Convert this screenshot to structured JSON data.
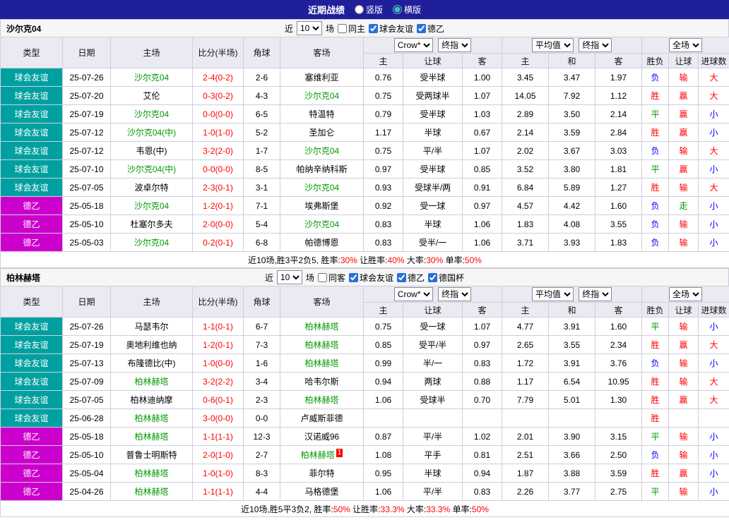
{
  "topbar": {
    "title": "近期战绩",
    "radio_vertical": "竖版",
    "radio_horizontal": "横版"
  },
  "controls": {
    "near": "近",
    "count": "10",
    "games": "场",
    "bookmaker": "Crow*",
    "final_index": "终指",
    "average": "平均值",
    "full_match": "全场"
  },
  "header": {
    "static": [
      "类型",
      "日期",
      "主场",
      "比分(半场)",
      "角球",
      "客场"
    ],
    "handicap": [
      "主",
      "让球",
      "客"
    ],
    "average": [
      "主",
      "和",
      "客"
    ],
    "result": [
      "胜负",
      "让球",
      "进球数"
    ]
  },
  "colors": {
    "topbar_bg": "#1f1f9c",
    "friendly_bg": "#00a0a0",
    "league2_bg": "#cc00cc",
    "focus_team": "#009900",
    "score": "#ff0000",
    "win": "#ff0000",
    "draw": "#009900",
    "lose": "#0000ff",
    "cover": "#ff0000",
    "push": "#009900",
    "over": "#ff0000",
    "under": "#0000ff"
  },
  "sections": [
    {
      "team": "沙尔克04",
      "same_label": "同主",
      "leagues": [
        "球会友谊",
        "德乙"
      ],
      "rows": [
        {
          "league": "球会友谊",
          "date": "25-07-26",
          "home": "沙尔克04",
          "home_focus": true,
          "score": "2-4(0-2)",
          "corners": "2-6",
          "away": "塞维利亚",
          "away_focus": false,
          "odds_home": "0.76",
          "handicap": "受半球",
          "odds_away": "1.00",
          "avg_home": "3.45",
          "avg_draw": "3.47",
          "avg_away": "1.97",
          "result": "负",
          "handicap_result": "输",
          "goals": "大"
        },
        {
          "league": "球会友谊",
          "date": "25-07-20",
          "home": "艾伦",
          "home_focus": false,
          "score": "0-3(0-2)",
          "corners": "4-3",
          "away": "沙尔克04",
          "away_focus": true,
          "odds_home": "0.75",
          "handicap": "受两球半",
          "odds_away": "1.07",
          "avg_home": "14.05",
          "avg_draw": "7.92",
          "avg_away": "1.12",
          "result": "胜",
          "handicap_result": "赢",
          "goals": "大"
        },
        {
          "league": "球会友谊",
          "date": "25-07-19",
          "home": "沙尔克04",
          "home_focus": true,
          "score": "0-0(0-0)",
          "corners": "6-5",
          "away": "特温特",
          "away_focus": false,
          "odds_home": "0.79",
          "handicap": "受半球",
          "odds_away": "1.03",
          "avg_home": "2.89",
          "avg_draw": "3.50",
          "avg_away": "2.14",
          "result": "平",
          "handicap_result": "赢",
          "goals": "小"
        },
        {
          "league": "球会友谊",
          "date": "25-07-12",
          "home": "沙尔克04(中)",
          "home_focus": true,
          "score": "1-0(1-0)",
          "corners": "5-2",
          "away": "圣加仑",
          "away_focus": false,
          "odds_home": "1.17",
          "handicap": "半球",
          "odds_away": "0.67",
          "avg_home": "2.14",
          "avg_draw": "3.59",
          "avg_away": "2.84",
          "result": "胜",
          "handicap_result": "赢",
          "goals": "小"
        },
        {
          "league": "球会友谊",
          "date": "25-07-12",
          "home": "韦恩(中)",
          "home_focus": false,
          "score": "3-2(2-0)",
          "corners": "1-7",
          "away": "沙尔克04",
          "away_focus": true,
          "odds_home": "0.75",
          "handicap": "平/半",
          "odds_away": "1.07",
          "avg_home": "2.02",
          "avg_draw": "3.67",
          "avg_away": "3.03",
          "result": "负",
          "handicap_result": "输",
          "goals": "大"
        },
        {
          "league": "球会友谊",
          "date": "25-07-10",
          "home": "沙尔克04(中)",
          "home_focus": true,
          "score": "0-0(0-0)",
          "corners": "8-5",
          "away": "帕纳辛纳科斯",
          "away_focus": false,
          "odds_home": "0.97",
          "handicap": "受半球",
          "odds_away": "0.85",
          "avg_home": "3.52",
          "avg_draw": "3.80",
          "avg_away": "1.81",
          "result": "平",
          "handicap_result": "赢",
          "goals": "小"
        },
        {
          "league": "球会友谊",
          "date": "25-07-05",
          "home": "波卓尔特",
          "home_focus": false,
          "score": "2-3(0-1)",
          "corners": "3-1",
          "away": "沙尔克04",
          "away_focus": true,
          "odds_home": "0.93",
          "handicap": "受球半/两",
          "odds_away": "0.91",
          "avg_home": "6.84",
          "avg_draw": "5.89",
          "avg_away": "1.27",
          "result": "胜",
          "handicap_result": "输",
          "goals": "大"
        },
        {
          "league": "德乙",
          "date": "25-05-18",
          "home": "沙尔克04",
          "home_focus": true,
          "score": "1-2(0-1)",
          "corners": "7-1",
          "away": "埃弗斯堡",
          "away_focus": false,
          "odds_home": "0.92",
          "handicap": "受一球",
          "odds_away": "0.97",
          "avg_home": "4.57",
          "avg_draw": "4.42",
          "avg_away": "1.60",
          "result": "负",
          "handicap_result": "走",
          "goals": "小"
        },
        {
          "league": "德乙",
          "date": "25-05-10",
          "home": "杜塞尔多夫",
          "home_focus": false,
          "score": "2-0(0-0)",
          "corners": "5-4",
          "away": "沙尔克04",
          "away_focus": true,
          "odds_home": "0.83",
          "handicap": "半球",
          "odds_away": "1.06",
          "avg_home": "1.83",
          "avg_draw": "4.08",
          "avg_away": "3.55",
          "result": "负",
          "handicap_result": "输",
          "goals": "小"
        },
        {
          "league": "德乙",
          "date": "25-05-03",
          "home": "沙尔克04",
          "home_focus": true,
          "score": "0-2(0-1)",
          "corners": "6-8",
          "away": "帕德博恩",
          "away_focus": false,
          "odds_home": "0.83",
          "handicap": "受半/一",
          "odds_away": "1.06",
          "avg_home": "3.71",
          "avg_draw": "3.93",
          "avg_away": "1.83",
          "result": "负",
          "handicap_result": "输",
          "goals": "小"
        }
      ],
      "summary": {
        "prefix": "近10场,胜3平2负5,",
        "rates": [
          {
            "label": "胜率:",
            "value": "30%"
          },
          {
            "label": "让胜率:",
            "value": "40%"
          },
          {
            "label": "大率:",
            "value": "30%"
          },
          {
            "label": "单率:",
            "value": "50%"
          }
        ]
      }
    },
    {
      "team": "柏林赫塔",
      "same_label": "同客",
      "leagues": [
        "球会友谊",
        "德乙",
        "德国杯"
      ],
      "rows": [
        {
          "league": "球会友谊",
          "date": "25-07-26",
          "home": "马瑟韦尔",
          "home_focus": false,
          "score": "1-1(0-1)",
          "corners": "6-7",
          "away": "柏林赫塔",
          "away_focus": true,
          "odds_home": "0.75",
          "handicap": "受一球",
          "odds_away": "1.07",
          "avg_home": "4.77",
          "avg_draw": "3.91",
          "avg_away": "1.60",
          "result": "平",
          "handicap_result": "输",
          "goals": "小"
        },
        {
          "league": "球会友谊",
          "date": "25-07-19",
          "home": "奥地利维也纳",
          "home_focus": false,
          "score": "1-2(0-1)",
          "corners": "7-3",
          "away": "柏林赫塔",
          "away_focus": true,
          "odds_home": "0.85",
          "handicap": "受平/半",
          "odds_away": "0.97",
          "avg_home": "2.65",
          "avg_draw": "3.55",
          "avg_away": "2.34",
          "result": "胜",
          "handicap_result": "赢",
          "goals": "大"
        },
        {
          "league": "球会友谊",
          "date": "25-07-13",
          "home": "布隆德比(中)",
          "home_focus": false,
          "score": "1-0(0-0)",
          "corners": "1-6",
          "away": "柏林赫塔",
          "away_focus": true,
          "odds_home": "0.99",
          "handicap": "半/一",
          "odds_away": "0.83",
          "avg_home": "1.72",
          "avg_draw": "3.91",
          "avg_away": "3.76",
          "result": "负",
          "handicap_result": "输",
          "goals": "小"
        },
        {
          "league": "球会友谊",
          "date": "25-07-09",
          "home": "柏林赫塔",
          "home_focus": true,
          "score": "3-2(2-2)",
          "corners": "3-4",
          "away": "哈韦尔斯",
          "away_focus": false,
          "odds_home": "0.94",
          "handicap": "两球",
          "odds_away": "0.88",
          "avg_home": "1.17",
          "avg_draw": "6.54",
          "avg_away": "10.95",
          "result": "胜",
          "handicap_result": "输",
          "goals": "大"
        },
        {
          "league": "球会友谊",
          "date": "25-07-05",
          "home": "柏林迪纳摩",
          "home_focus": false,
          "score": "0-6(0-1)",
          "corners": "2-3",
          "away": "柏林赫塔",
          "away_focus": true,
          "odds_home": "1.06",
          "handicap": "受球半",
          "odds_away": "0.70",
          "avg_home": "7.79",
          "avg_draw": "5.01",
          "avg_away": "1.30",
          "result": "胜",
          "handicap_result": "赢",
          "goals": "大"
        },
        {
          "league": "球会友谊",
          "date": "25-06-28",
          "home": "柏林赫塔",
          "home_focus": true,
          "score": "3-0(0-0)",
          "corners": "0-0",
          "away": "卢威斯菲德",
          "away_focus": false,
          "odds_home": "",
          "handicap": "",
          "odds_away": "",
          "avg_home": "",
          "avg_draw": "",
          "avg_away": "",
          "result": "胜",
          "handicap_result": "",
          "goals": ""
        },
        {
          "league": "德乙",
          "date": "25-05-18",
          "home": "柏林赫塔",
          "home_focus": true,
          "score": "1-1(1-1)",
          "corners": "12-3",
          "away": "汉诺威96",
          "away_focus": false,
          "odds_home": "0.87",
          "handicap": "平/半",
          "odds_away": "1.02",
          "avg_home": "2.01",
          "avg_draw": "3.90",
          "avg_away": "3.15",
          "result": "平",
          "handicap_result": "输",
          "goals": "小"
        },
        {
          "league": "德乙",
          "date": "25-05-10",
          "home": "普鲁士明斯特",
          "home_focus": false,
          "score": "2-0(1-0)",
          "corners": "2-7",
          "away": "柏林赫塔",
          "away_focus": true,
          "away_badge": "1",
          "odds_home": "1.08",
          "handicap": "平手",
          "odds_away": "0.81",
          "avg_home": "2.51",
          "avg_draw": "3.66",
          "avg_away": "2.50",
          "result": "负",
          "handicap_result": "输",
          "goals": "小"
        },
        {
          "league": "德乙",
          "date": "25-05-04",
          "home": "柏林赫塔",
          "home_focus": true,
          "score": "1-0(1-0)",
          "corners": "8-3",
          "away": "菲尔特",
          "away_focus": false,
          "odds_home": "0.95",
          "handicap": "半球",
          "odds_away": "0.94",
          "avg_home": "1.87",
          "avg_draw": "3.88",
          "avg_away": "3.59",
          "result": "胜",
          "handicap_result": "赢",
          "goals": "小"
        },
        {
          "league": "德乙",
          "date": "25-04-26",
          "home": "柏林赫塔",
          "home_focus": true,
          "score": "1-1(1-1)",
          "corners": "4-4",
          "away": "马格德堡",
          "away_focus": false,
          "odds_home": "1.06",
          "handicap": "平/半",
          "odds_away": "0.83",
          "avg_home": "2.26",
          "avg_draw": "3.77",
          "avg_away": "2.75",
          "result": "平",
          "handicap_result": "输",
          "goals": "小"
        }
      ],
      "summary": {
        "prefix": "近10场,胜5平3负2,",
        "rates": [
          {
            "label": "胜率:",
            "value": "50%"
          },
          {
            "label": "让胜率:",
            "value": "33.3%"
          },
          {
            "label": "大率:",
            "value": "33.3%"
          },
          {
            "label": "单率:",
            "value": "50%"
          }
        ]
      }
    }
  ]
}
